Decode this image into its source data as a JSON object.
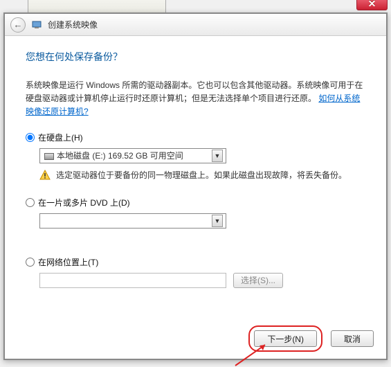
{
  "window": {
    "title": "创建系统映像"
  },
  "page": {
    "heading": "您想在何处保存备份？",
    "description": "系统映像是运行 Windows 所需的驱动器副本。它也可以包含其他驱动器。系统映像可用于在硬盘驱动器或计算机停止运行时还原计算机；但是无法选择单个项目进行还原。",
    "link_text": "如何从系统映像还原计算机?"
  },
  "options": {
    "hdd": {
      "label": "在硬盘上(H)",
      "selected_value": "本地磁盘 (E:)  169.52 GB 可用空间",
      "warning": "选定驱动器位于要备份的同一物理磁盘上。如果此磁盘出现故障，将丢失备份。"
    },
    "dvd": {
      "label": "在一片或多片 DVD 上(D)",
      "selected_value": ""
    },
    "network": {
      "label": "在网络位置上(T)",
      "path_value": "",
      "browse_label": "选择(S)..."
    }
  },
  "footer": {
    "next": "下一步(N)",
    "cancel": "取消"
  }
}
